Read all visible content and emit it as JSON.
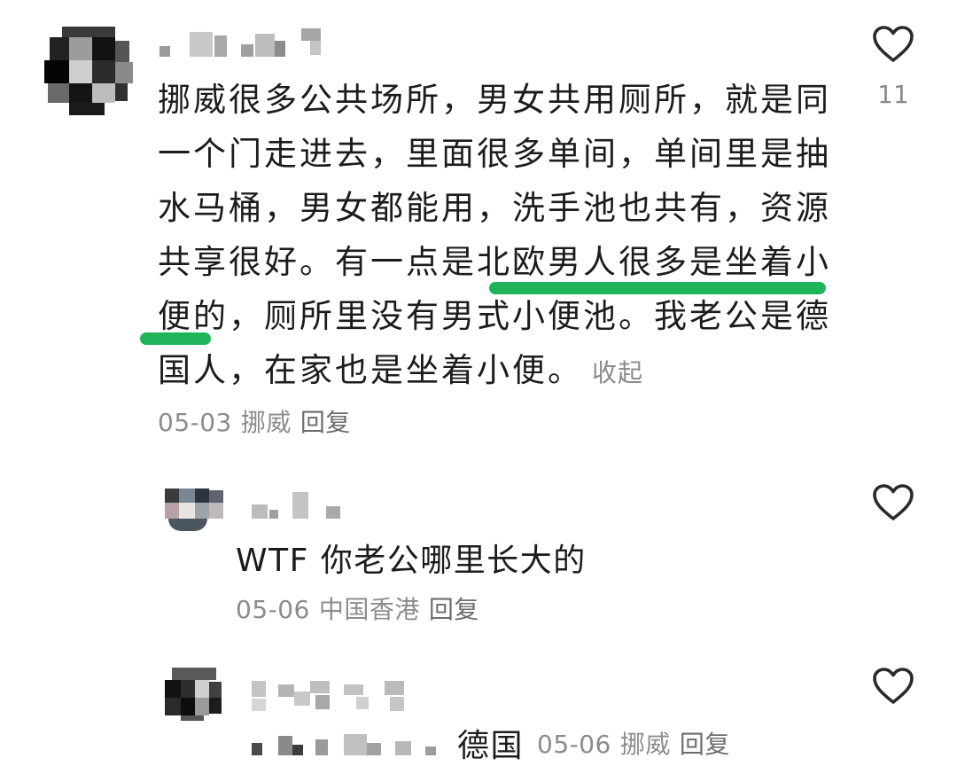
{
  "comments": [
    {
      "text": "挪威很多公共场所，男女共用厕所，就是同一个门走进去，里面很多单间，单间里是抽水马桶，男女都能用，洗手池也共有，资源共享很好。有一点是北欧男人很多是坐着小便的，厕所里没有男式小便池。我老公是德国人，在家也是坐着小便。",
      "collapse_label": "收起",
      "date": "05-03",
      "location": "挪威",
      "reply_label": "回复",
      "likes": "11"
    }
  ],
  "replies": [
    {
      "text": "WTF 你老公哪里长大的",
      "date": "05-06",
      "location": "中国香港",
      "reply_label": "回复"
    },
    {
      "text": "德国",
      "date": "05-06",
      "location": "挪威",
      "reply_label": "回复"
    }
  ],
  "colors": {
    "highlight": "#1fb45a",
    "meta_text": "#8c8c8c",
    "body_text": "#1c1c1c"
  },
  "icons": {
    "like": "heart-outline-icon"
  }
}
